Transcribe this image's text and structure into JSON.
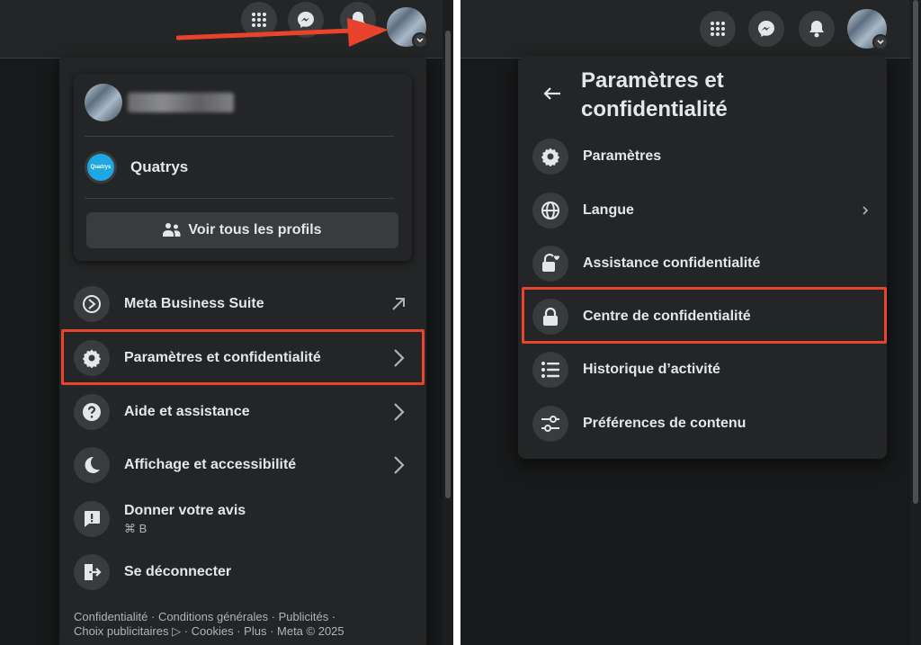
{
  "left_menu": {
    "profile_name": "",
    "page_name": "Quatrys",
    "page_logo_text": "Quatrys",
    "see_all_profiles": "Voir tous les profils",
    "items": [
      {
        "label": "Meta Business Suite"
      },
      {
        "label": "Paramètres et confidentialité"
      },
      {
        "label": "Aide et assistance"
      },
      {
        "label": "Affichage et accessibilité"
      },
      {
        "label": "Donner votre avis",
        "shortcut": "⌘ B"
      },
      {
        "label": "Se déconnecter"
      }
    ],
    "footer": {
      "line1": "Confidentialité · Conditions générales · Publicités ·",
      "line2": "Choix publicitaires ▷ · Cookies · Plus · Meta © 2025"
    }
  },
  "right_menu": {
    "title": "Paramètres et confidentialité",
    "items": [
      {
        "label": "Paramètres"
      },
      {
        "label": "Langue"
      },
      {
        "label": "Assistance confidentialité"
      },
      {
        "label": "Centre de confidentialité"
      },
      {
        "label": "Historique d’activité"
      },
      {
        "label": "Préférences de contenu"
      }
    ]
  },
  "colors": {
    "background": "#18191a",
    "surface": "#242526",
    "icon_bg": "#3a3b3c",
    "text": "#e4e6eb",
    "highlight": "#e8432d",
    "arrow": "#e8432d"
  },
  "icons": [
    "apps-grid-icon",
    "messenger-icon",
    "bell-icon",
    "avatar",
    "arrow-left-icon",
    "gear-icon",
    "globe-icon",
    "lock-heart-icon",
    "lock-icon",
    "list-icon",
    "sliders-icon",
    "meta-business-icon",
    "help-icon",
    "moon-icon",
    "feedback-icon",
    "logout-icon",
    "chevron-right-icon",
    "external-arrow-icon"
  ]
}
